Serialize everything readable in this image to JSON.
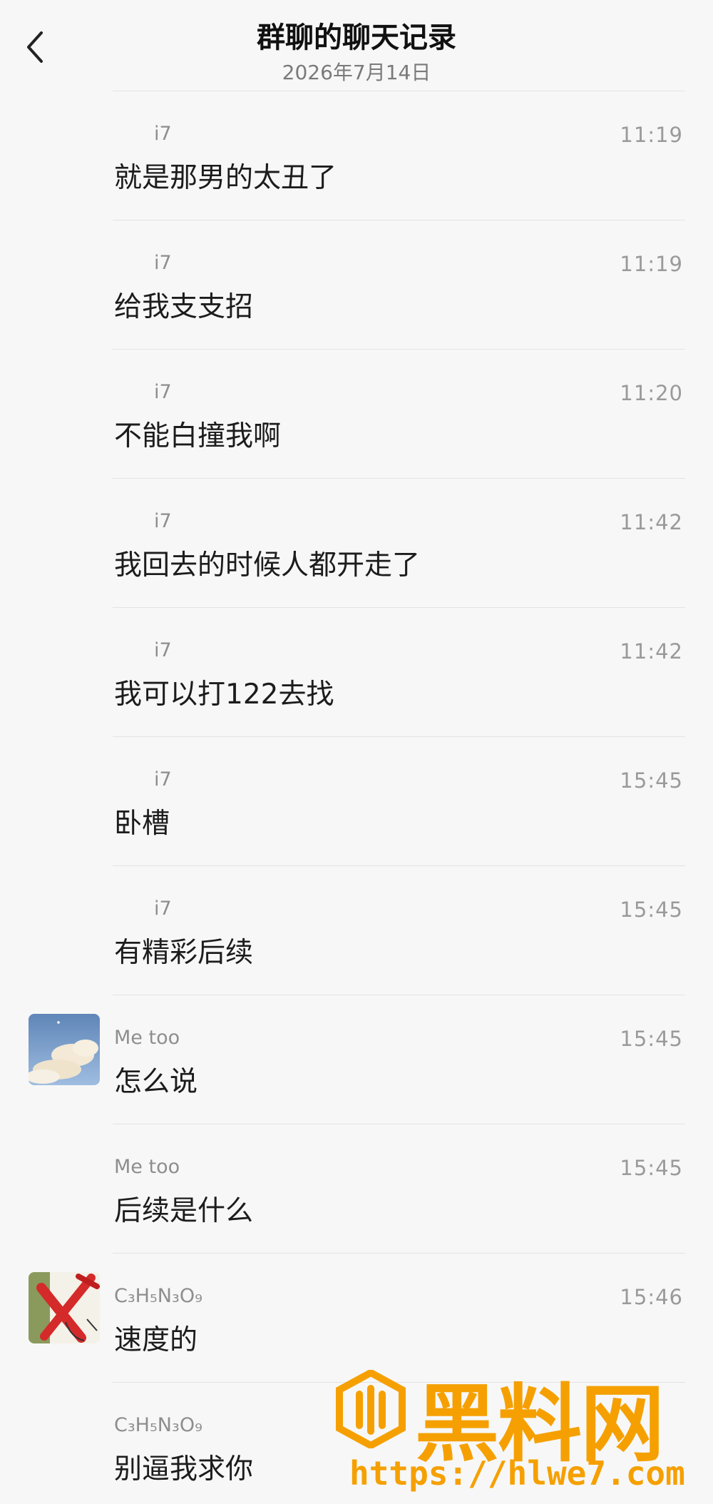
{
  "header": {
    "title": "群聊的聊天记录",
    "date": "2026年7月14日"
  },
  "messages": [
    {
      "sender": "i7",
      "time": "11:19",
      "text": "就是那男的太丑了"
    },
    {
      "sender": "i7",
      "time": "11:19",
      "text": "给我支支招"
    },
    {
      "sender": "i7",
      "time": "11:20",
      "text": "不能白撞我啊"
    },
    {
      "sender": "i7",
      "time": "11:42",
      "text": "我回去的时候人都开走了"
    },
    {
      "sender": "i7",
      "time": "11:42",
      "text": "我可以打122去找"
    },
    {
      "sender": "i7",
      "time": "15:45",
      "text": "卧槽"
    },
    {
      "sender": "i7",
      "time": "15:45",
      "text": "有精彩后续"
    },
    {
      "sender": "Me too",
      "time": "15:45",
      "text": "怎么说"
    },
    {
      "sender": "Me too",
      "time": "15:45",
      "text": "后续是什么"
    },
    {
      "sender": "C₃H₅N₃O₉",
      "time": "15:46",
      "text": "速度的"
    },
    {
      "sender": "C₃H₅N₃O₉",
      "time": "",
      "text": "别逼我求你"
    }
  ],
  "watermark": {
    "name": "黑料网",
    "url": "https://hlwe7.com"
  },
  "colors": {
    "background": "#f7f7f7",
    "watermark": "#f5a000"
  }
}
